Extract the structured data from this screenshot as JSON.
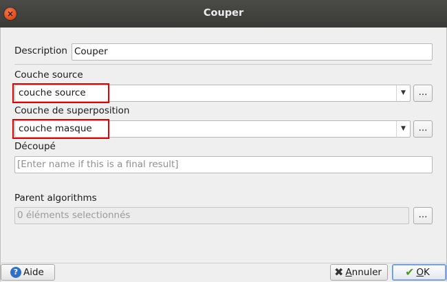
{
  "window": {
    "title": "Couper",
    "close_glyph": "×"
  },
  "description": {
    "label": "Description",
    "value": "Couper"
  },
  "source_layer": {
    "label": "Couche source",
    "value": "couche source",
    "browse": "…"
  },
  "overlay_layer": {
    "label": "Couche de superposition",
    "value": "couche masque",
    "browse": "…"
  },
  "output": {
    "label": "Découpé",
    "placeholder": "[Enter name if this is a final result]"
  },
  "parent_algorithms": {
    "label": "Parent algorithms",
    "value": "0 éléments selectionnés",
    "browse": "…"
  },
  "buttons": {
    "help": "Aide",
    "help_glyph": "?",
    "cancel_mnemonic": "A",
    "cancel_rest": "nnuler",
    "cancel_glyph": "✖",
    "ok_mnemonic": "O",
    "ok_rest": "K",
    "ok_glyph": "✔"
  },
  "icons": {
    "close": "close-icon",
    "help": "help-icon",
    "cancel": "cancel-icon",
    "ok": "checkmark-icon",
    "combo_arrow": "triangle-down-icon"
  },
  "colors": {
    "highlight": "#e60000",
    "titlebar": "#3d3d3a",
    "close": "#e0501f",
    "help_icon": "#2e6fc9",
    "ok_icon": "#4a9a1a"
  }
}
